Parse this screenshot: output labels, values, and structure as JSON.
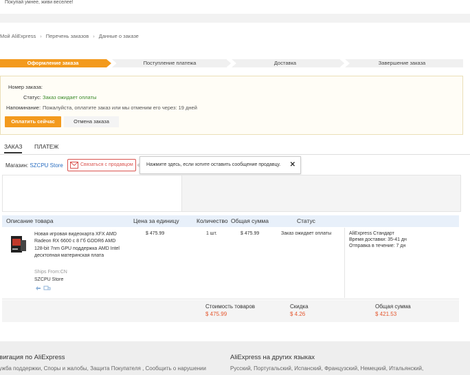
{
  "header": {
    "tagline": "Покупай умнее, живи веселее!"
  },
  "breadcrumb": [
    "Мой AliExpress",
    "Перечень заказов",
    "Данные о заказе"
  ],
  "steps": [
    "Оформление заказа",
    "Поступление платежа",
    "Доставка",
    "Завершение заказа"
  ],
  "order": {
    "number_label": "Номер заказа:",
    "status_label": "Статус:",
    "status_value": "Заказ ожидает оплаты",
    "reminder_label": "Напоминание:",
    "reminder_text": "Пожалуйста, оплатите заказ или мы отменим его через: 19 дней",
    "pay_button": "Оплатить сейчас",
    "cancel_button": "Отмена заказа"
  },
  "tabs": [
    "ЗАКАЗ",
    "ПЛАТЕЖ"
  ],
  "store": {
    "label": "Магазин:",
    "name": "SZCPU Store",
    "contact_button": "Связаться с продавцом",
    "tooltip": "Нажмите здесь, если хотите оставить сообщение продавцу."
  },
  "table": {
    "headers": [
      "Описание товара",
      "Цена за единицу",
      "Количество",
      "Общая сумма",
      "Статус"
    ],
    "item": {
      "name": "Новая игровая видеокарта XFX AMD Radeon RX 6600 с 8 Гб GDDR6 AMD 128-bit 7nm GPU поддержка AMD Intel десктопная материнская плата",
      "ships_from": "Ships From:CN",
      "store": "SZCPU Store",
      "unit_price": "$ 475.99",
      "quantity": "1 шт.",
      "total": "$ 475.99",
      "status": "Заказ ожидает оплаты",
      "shipping_method": "AliExpress Стандарт",
      "delivery_time": "Время доставки: 35-41 дн",
      "dispatch": "Отправка в течение: 7 дн"
    }
  },
  "summary": {
    "goods_label": "Стоимость товаров",
    "goods_value": "$ 475.99",
    "discount_label": "Скидка",
    "discount_value": "$ 4.26",
    "total_label": "Общая сумма",
    "total_value": "$ 421.53"
  },
  "footer": {
    "nav_title": "Навигация по AliExpress",
    "nav_links": "Служба поддержки, Споры и жалобы, Защита Покупателя , Сообщить о нарушении",
    "lang_title": "AliExpress на других языках",
    "lang_links": "Русский, Португальский, Испанский, Французский, Немецкий, Итальянский,"
  },
  "colors": {
    "accent": "#f39a1d",
    "link": "#2a6ec1",
    "price": "#e4572e",
    "status_green": "#3a8a2a"
  }
}
